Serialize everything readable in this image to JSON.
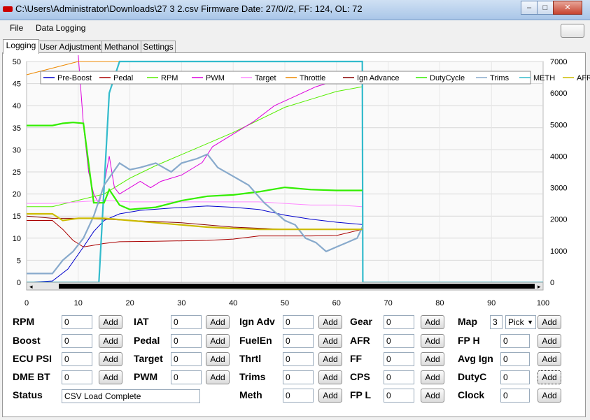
{
  "window": {
    "title": "C:\\Users\\Administrator\\Downloads\\27 3 2.csv Firmware Date: 27/0//2, FF: 124, OL: 72",
    "minimize": "–",
    "maximize": "□",
    "close": "✕"
  },
  "menu": [
    "File",
    "Data Logging"
  ],
  "tabs": [
    "Logging",
    "User Adjustment",
    "Methanol",
    "Settings"
  ],
  "chart_data": {
    "type": "line",
    "x_ticks": [
      0,
      10,
      20,
      30,
      40,
      50,
      60,
      70,
      80,
      90,
      100
    ],
    "y_left_ticks": [
      0,
      5,
      10,
      15,
      20,
      25,
      30,
      35,
      40,
      45,
      50
    ],
    "y_right_ticks": [
      0,
      1000,
      2000,
      3000,
      4000,
      5000,
      6000,
      7000
    ],
    "xlim": [
      0,
      100
    ],
    "ylim_left": [
      0,
      50
    ],
    "ylim_right": [
      0,
      7000
    ],
    "grid": true,
    "legend_placement": "top-left",
    "series": [
      {
        "name": "Pre-Boost",
        "color": "#0000cc",
        "axis": "left",
        "points": [
          [
            0,
            0
          ],
          [
            5,
            0.3
          ],
          [
            8,
            3
          ],
          [
            11,
            8
          ],
          [
            13,
            11.5
          ],
          [
            15,
            14
          ],
          [
            18,
            15.5
          ],
          [
            22,
            16.3
          ],
          [
            28,
            16.8
          ],
          [
            35,
            17.3
          ],
          [
            40,
            17
          ],
          [
            45,
            16.5
          ],
          [
            50,
            15.2
          ],
          [
            55,
            14.3
          ],
          [
            60,
            13.6
          ],
          [
            65,
            13.1
          ]
        ]
      },
      {
        "name": "Pedal",
        "color": "#aa0000",
        "axis": "left",
        "points": [
          [
            0,
            14
          ],
          [
            5,
            14
          ],
          [
            7,
            12
          ],
          [
            9,
            9.5
          ],
          [
            11,
            8
          ],
          [
            15,
            8.8
          ],
          [
            18,
            9.2
          ],
          [
            25,
            9.3
          ],
          [
            35,
            9.5
          ],
          [
            40,
            9.8
          ],
          [
            45,
            10.5
          ],
          [
            55,
            10.5
          ],
          [
            60,
            10.6
          ],
          [
            65,
            12
          ]
        ]
      },
      {
        "name": "RPM",
        "color": "#55ee00",
        "axis": "right",
        "points": [
          [
            0,
            2400
          ],
          [
            5,
            2400
          ],
          [
            10,
            2600
          ],
          [
            15,
            2800
          ],
          [
            20,
            3300
          ],
          [
            25,
            3700
          ],
          [
            30,
            4050
          ],
          [
            35,
            4400
          ],
          [
            40,
            4750
          ],
          [
            45,
            5150
          ],
          [
            50,
            5550
          ],
          [
            55,
            5800
          ],
          [
            60,
            6050
          ],
          [
            65,
            6200
          ]
        ]
      },
      {
        "name": "PWM",
        "color": "#dd00dd",
        "axis": "right",
        "points": [
          [
            10,
            7200
          ],
          [
            11,
            5000
          ],
          [
            12,
            3500
          ],
          [
            13,
            2800
          ],
          [
            14,
            2500
          ],
          [
            15,
            3100
          ],
          [
            16,
            4000
          ],
          [
            17,
            3000
          ],
          [
            18,
            2800
          ],
          [
            20,
            3000
          ],
          [
            22,
            3200
          ],
          [
            24,
            3000
          ],
          [
            26,
            3200
          ],
          [
            28,
            3300
          ],
          [
            30,
            3400
          ],
          [
            32,
            3600
          ],
          [
            34,
            3800
          ],
          [
            36,
            4300
          ],
          [
            40,
            4700
          ],
          [
            44,
            5100
          ],
          [
            48,
            5600
          ],
          [
            52,
            5900
          ],
          [
            56,
            6200
          ],
          [
            60,
            6400
          ],
          [
            65,
            6600
          ]
        ]
      },
      {
        "name": "Target",
        "color": "#ff88ff",
        "axis": "right",
        "points": [
          [
            0,
            2500
          ],
          [
            5,
            2500
          ],
          [
            10,
            2550
          ],
          [
            15,
            2600
          ],
          [
            20,
            2550
          ],
          [
            25,
            2550
          ],
          [
            30,
            2550
          ],
          [
            40,
            2550
          ],
          [
            45,
            2550
          ],
          [
            50,
            2500
          ],
          [
            55,
            2450
          ],
          [
            60,
            2450
          ],
          [
            65,
            2400
          ]
        ]
      },
      {
        "name": "Throttle",
        "color": "#ee8800",
        "axis": "left",
        "points": [
          [
            0,
            47
          ],
          [
            5,
            48.5
          ],
          [
            10,
            50
          ],
          [
            15,
            50
          ],
          [
            20,
            50
          ],
          [
            30,
            50
          ],
          [
            40,
            50
          ],
          [
            50,
            50
          ],
          [
            60,
            50
          ],
          [
            65,
            50
          ]
        ]
      },
      {
        "name": "Ign Advance",
        "color": "#880000",
        "axis": "left",
        "points": [
          [
            0,
            15
          ],
          [
            5,
            14.5
          ],
          [
            10,
            14.5
          ],
          [
            15,
            14.3
          ],
          [
            20,
            14
          ],
          [
            30,
            13.5
          ],
          [
            40,
            12.5
          ],
          [
            50,
            12
          ],
          [
            60,
            12
          ],
          [
            65,
            12
          ]
        ]
      },
      {
        "name": "DutyCycle",
        "color": "#33ee00",
        "axis": "left",
        "points": [
          [
            0,
            35.5
          ],
          [
            5,
            35.5
          ],
          [
            7,
            36
          ],
          [
            9,
            36.2
          ],
          [
            11,
            36
          ],
          [
            13,
            18
          ],
          [
            15,
            18
          ],
          [
            16,
            21
          ],
          [
            18,
            17.5
          ],
          [
            20,
            16.5
          ],
          [
            25,
            17
          ],
          [
            30,
            18.5
          ],
          [
            35,
            19.5
          ],
          [
            40,
            19.8
          ],
          [
            45,
            20.5
          ],
          [
            50,
            21.5
          ],
          [
            55,
            21
          ],
          [
            60,
            20.8
          ],
          [
            65,
            20.8
          ]
        ]
      },
      {
        "name": "Trims",
        "color": "#88aacc",
        "axis": "left",
        "points": [
          [
            0,
            2
          ],
          [
            5,
            2
          ],
          [
            7,
            5
          ],
          [
            9,
            7
          ],
          [
            11,
            10
          ],
          [
            13,
            15
          ],
          [
            15,
            22
          ],
          [
            18,
            27
          ],
          [
            20,
            25.5
          ],
          [
            22,
            26
          ],
          [
            25,
            27
          ],
          [
            28,
            25
          ],
          [
            30,
            27
          ],
          [
            33,
            28
          ],
          [
            35,
            29
          ],
          [
            37,
            26
          ],
          [
            40,
            24
          ],
          [
            43,
            22
          ],
          [
            46,
            18
          ],
          [
            50,
            14
          ],
          [
            52,
            13
          ],
          [
            54,
            10
          ],
          [
            56,
            9
          ],
          [
            58,
            7
          ],
          [
            60,
            8
          ],
          [
            62,
            9
          ],
          [
            64,
            10
          ],
          [
            65,
            12.5
          ]
        ]
      },
      {
        "name": "METH",
        "color": "#33bbcc",
        "axis": "right",
        "points": [
          [
            0,
            0
          ],
          [
            14,
            0
          ],
          [
            16,
            6000
          ],
          [
            18,
            7000
          ],
          [
            65,
            7000
          ],
          [
            65.1,
            0
          ],
          [
            100,
            0
          ]
        ]
      },
      {
        "name": "AFR",
        "color": "#ccbb00",
        "axis": "left",
        "points": [
          [
            0,
            15.5
          ],
          [
            5,
            15.5
          ],
          [
            7,
            14
          ],
          [
            10,
            14.5
          ],
          [
            15,
            14.5
          ],
          [
            20,
            14
          ],
          [
            25,
            13.5
          ],
          [
            30,
            13
          ],
          [
            35,
            12.5
          ],
          [
            40,
            12.2
          ],
          [
            45,
            12
          ],
          [
            50,
            12
          ],
          [
            55,
            12
          ],
          [
            60,
            12
          ],
          [
            65,
            12
          ]
        ]
      }
    ]
  },
  "fields": {
    "rpm": {
      "label": "RPM",
      "value": "0"
    },
    "boost": {
      "label": "Boost",
      "value": "0"
    },
    "ecu_psi": {
      "label": "ECU PSI",
      "value": "0"
    },
    "dme_bt": {
      "label": "DME BT",
      "value": "0"
    },
    "iat": {
      "label": "IAT",
      "value": "0"
    },
    "pedal": {
      "label": "Pedal",
      "value": "0"
    },
    "target": {
      "label": "Target",
      "value": "0"
    },
    "pwm": {
      "label": "PWM",
      "value": "0"
    },
    "ign_adv": {
      "label": "Ign Adv",
      "value": "0"
    },
    "fuelen": {
      "label": "FuelEn",
      "value": "0"
    },
    "thrtl": {
      "label": "Thrtl",
      "value": "0"
    },
    "trims": {
      "label": "Trims",
      "value": "0"
    },
    "meth": {
      "label": "Meth",
      "value": "0"
    },
    "gear": {
      "label": "Gear",
      "value": "0"
    },
    "afr": {
      "label": "AFR",
      "value": "0"
    },
    "ff": {
      "label": "FF",
      "value": "0"
    },
    "cps": {
      "label": "CPS",
      "value": "0"
    },
    "fp_l": {
      "label": "FP L",
      "value": "0"
    },
    "map": {
      "label": "Map",
      "value": "3",
      "select": "Pick"
    },
    "fp_h": {
      "label": "FP H",
      "value": "0"
    },
    "avg_ign": {
      "label": "Avg Ign",
      "value": "0"
    },
    "dutyc": {
      "label": "DutyC",
      "value": "0"
    },
    "clock": {
      "label": "Clock",
      "value": "0"
    }
  },
  "status": {
    "label": "Status",
    "value": "CSV Load Complete"
  },
  "add_label": "Add"
}
